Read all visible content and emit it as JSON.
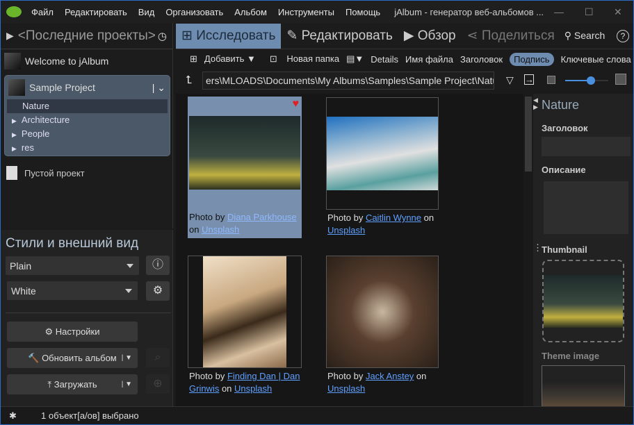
{
  "window": {
    "title": "jAlbum - генератор веб-альбомов ...",
    "minimize": "—",
    "maximize": "☐",
    "close": "✕"
  },
  "menu": [
    "Файл",
    "Редактировать",
    "Вид",
    "Организовать",
    "Альбом",
    "Инструменты",
    "Помощь"
  ],
  "left": {
    "recent": "<Последние проекты>",
    "welcome": "Welcome to jAlbum",
    "project": "Sample Project",
    "tree": [
      "Nature",
      "Architecture",
      "People",
      "res"
    ],
    "empty": "Пустой проект",
    "styles_title": "Стили и внешний вид",
    "skin": "Plain",
    "style": "White",
    "settings": "Настройки",
    "update": "Обновить альбом",
    "upload": "Загружать"
  },
  "tabs": [
    "Исследовать",
    "Редактировать",
    "Обзор",
    "Поделиться"
  ],
  "search": "Search",
  "help": "?",
  "toolbar": {
    "add": "Добавить",
    "new_folder": "Новая папка",
    "details": "Details",
    "filename": "Имя файла",
    "title": "Заголовок",
    "caption": "Подпись",
    "keywords": "Ключевые слова"
  },
  "path": "ers\\MLOADS\\Documents\\My Albums\\Samples\\Sample Project\\Nature",
  "slider": {
    "value": 0.6
  },
  "images": [
    {
      "prefix": "Photo by ",
      "author": "Diana Parkhouse",
      "mid": " on ",
      "site": "Unsplash",
      "selected": true,
      "favorite": true
    },
    {
      "prefix": "Photo by ",
      "author": "Caitlin Wynne",
      "mid": " on ",
      "site": "Unsplash"
    },
    {
      "prefix": "Photo by ",
      "author": "Finding Dan | Dan Grinwis",
      "mid": " on ",
      "site": "Unsplash"
    },
    {
      "prefix": "Photo by ",
      "author": "Jack Anstey",
      "mid": " on ",
      "site": "Unsplash"
    }
  ],
  "right": {
    "folder": "Nature",
    "title_label": "Заголовок",
    "desc_label": "Описание",
    "thumb_label": "Thumbnail",
    "theme_label": "Theme image"
  },
  "status": {
    "icon": "✱",
    "text": "1 объект[а/ов] выбрано"
  },
  "colors": {
    "accent": "#6d8cb0",
    "link": "#5fa0ff"
  }
}
